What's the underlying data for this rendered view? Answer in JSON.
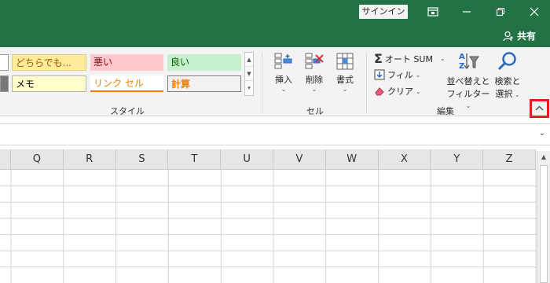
{
  "titlebar": {
    "signin_label": "サインイン",
    "share_label": "共有",
    "bg_color": "#217346"
  },
  "ribbon": {
    "styles_group": {
      "label": "スタイル",
      "cells": [
        {
          "text": "どちらでも...",
          "bg": "#ffeb9c",
          "fg": "#9c5700"
        },
        {
          "text": "悪い",
          "bg": "#ffc7ce",
          "fg": "#9c0006"
        },
        {
          "text": "良い",
          "bg": "#c6efce",
          "fg": "#006100"
        },
        {
          "text": "メモ",
          "bg": "#ffffcc",
          "fg": "#000000"
        },
        {
          "text": "リンク セル",
          "bg": "#ffffff",
          "fg": "#fa7d00"
        },
        {
          "text": "計算",
          "bg": "#f2f2f2",
          "fg": "#fa7d00"
        }
      ]
    },
    "cells_group": {
      "label": "セル",
      "insert_label": "挿入",
      "delete_label": "削除",
      "format_label": "書式"
    },
    "editing_group": {
      "label": "編集",
      "autosum_label": "オート SUM",
      "fill_label": "フィル",
      "clear_label": "クリア",
      "sort_filter_line1": "並べ替えと",
      "sort_filter_line2": "フィルター",
      "find_select_line1": "検索と",
      "find_select_line2": "選択"
    }
  },
  "sheet": {
    "columns": [
      "Q",
      "R",
      "S",
      "T",
      "U",
      "V",
      "W",
      "X",
      "Y",
      "Z"
    ]
  }
}
